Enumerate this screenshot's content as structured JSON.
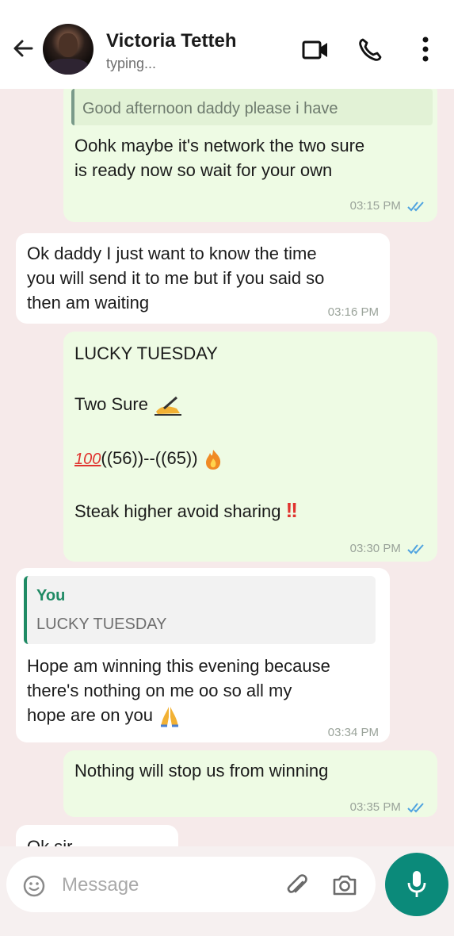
{
  "header": {
    "contact_name": "Victoria Tetteh",
    "status": "typing..."
  },
  "messages": [
    {
      "quoted_text": "Good afternoon daddy please i have",
      "text_lines": [
        "Oohk maybe it's network the two sure",
        "is ready now so wait for your own"
      ],
      "time": "03:15 PM"
    },
    {
      "text_lines": [
        "Ok daddy I just want to know the time",
        "you will send it to me but if you said so",
        "then am waiting"
      ],
      "time": "03:16 PM"
    },
    {
      "line1": "LUCKY TUESDAY",
      "line2": "Two Sure",
      "line3": "((56))--((65))",
      "line4": "Steak higher avoid sharing",
      "time": "03:30 PM"
    },
    {
      "quoted_author": "You",
      "quoted_text": "LUCKY TUESDAY",
      "text_lines": [
        "Hope am winning this evening because",
        "there's nothing on me oo so all my",
        "hope are on you"
      ],
      "time": "03:34 PM"
    },
    {
      "text": "Nothing will stop us from winning",
      "time": "03:35 PM"
    },
    {
      "text_partial": "Ok sir"
    }
  ],
  "composer": {
    "placeholder": "Message"
  },
  "colors": {
    "accent": "#0b8a7a",
    "read_ticks": "#4fa3e0",
    "outgoing_bubble": "#eefbe4",
    "incoming_bubble": "#ffffff"
  },
  "icons": {
    "back": "arrow-left",
    "video": "video-camera",
    "call": "phone",
    "menu": "vertical-dots",
    "emoji": "smiley",
    "attach": "paperclip",
    "camera": "camera",
    "mic": "microphone"
  }
}
